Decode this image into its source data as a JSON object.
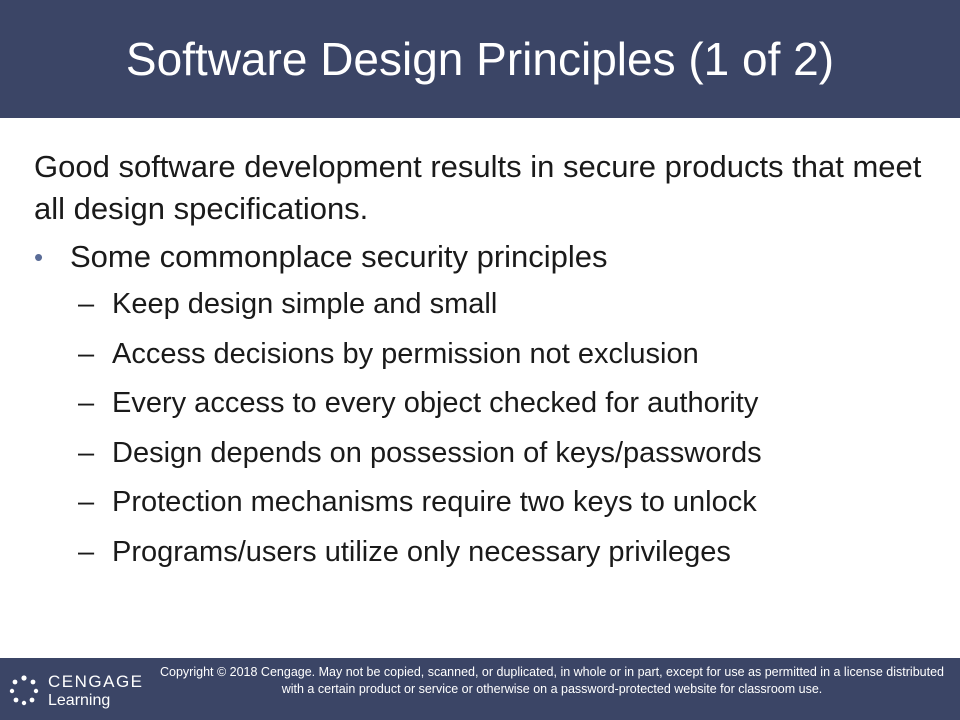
{
  "slide": {
    "title": "Software Design Principles (1 of 2)",
    "intro": "Good software development results in secure products that meet all design specifications.",
    "bullet": "Some commonplace security principles",
    "sub_items": [
      "Keep design simple and small",
      "Access decisions by permission not exclusion",
      "Every access to every object checked for authority",
      "Design depends on possession of keys/passwords",
      "Protection mechanisms require two keys to unlock",
      "Programs/users utilize only necessary privileges"
    ]
  },
  "footer": {
    "logo_line1": "CENGAGE",
    "logo_line2": "Learning",
    "logo_icon": "cengage-logo-icon",
    "copyright": "Copyright © 2018 Cengage. May not be copied, scanned, or duplicated, in whole or in part, except for use as permitted in a license distributed with a certain product or service or otherwise on a password-protected website for classroom use."
  },
  "colors": {
    "header_bg": "#3b4566",
    "footer_bg": "#3b4566",
    "title_text": "#ffffff",
    "bullet_marker": "#5a6c97"
  }
}
